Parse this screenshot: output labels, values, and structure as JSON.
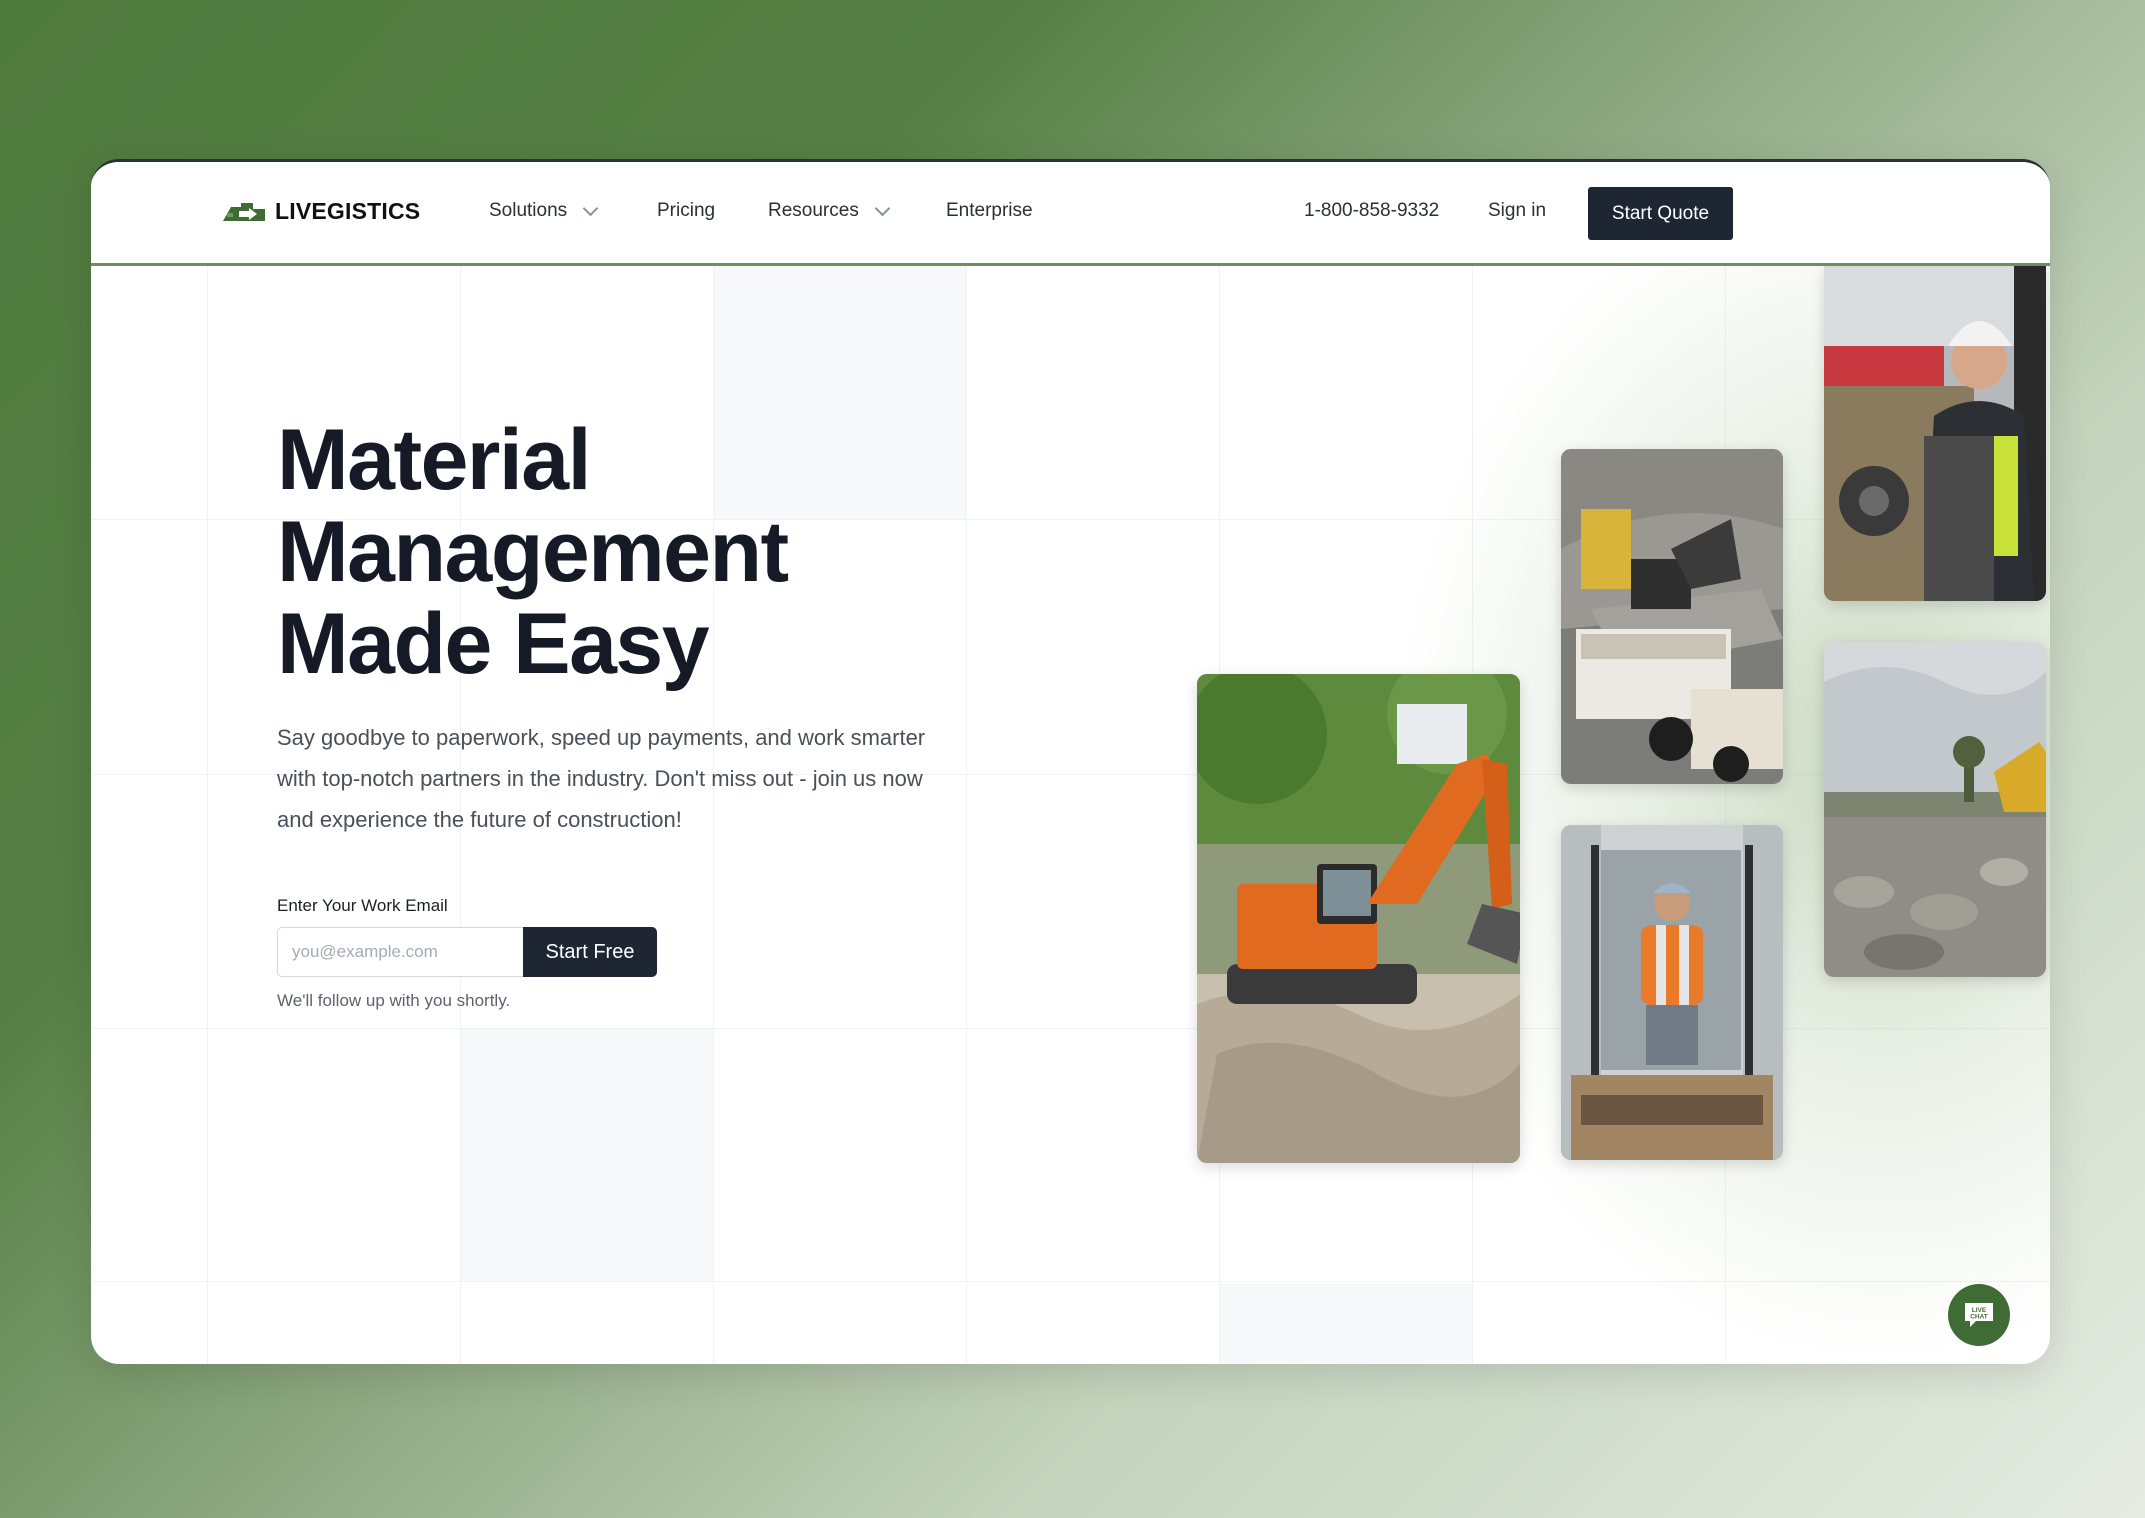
{
  "brand": {
    "name": "LIVEGISTICS",
    "accent": "#4f7a3e",
    "dark": "#1f2633"
  },
  "nav": {
    "items": [
      {
        "label": "Solutions",
        "dropdown": true
      },
      {
        "label": "Pricing",
        "dropdown": false
      },
      {
        "label": "Resources",
        "dropdown": true
      },
      {
        "label": "Enterprise",
        "dropdown": false
      }
    ],
    "phone": "1-800-858-9332",
    "signin": "Sign in",
    "cta": "Start Quote"
  },
  "hero": {
    "headline": [
      "Material",
      "Management",
      "Made Easy"
    ],
    "subtext": "Say goodbye to paperwork, speed up payments, and work smarter with top-notch partners in the industry. Don't miss out - join us now and experience the future of construction!",
    "email_label": "Enter Your Work Email",
    "email_placeholder": "you@example.com",
    "submit": "Start Free",
    "note": "We'll follow up with you shortly."
  },
  "photos": [
    {
      "name": "excavator-photo",
      "subject": "orange excavator on dirt site"
    },
    {
      "name": "dump-truck-photo",
      "subject": "loader filling dump trucks with gravel"
    },
    {
      "name": "loader-operator-photo",
      "subject": "worker operating skid steer"
    },
    {
      "name": "worker-portrait-photo",
      "subject": "construction worker in hard hat"
    },
    {
      "name": "rubble-site-photo",
      "subject": "rubble at demolition site"
    }
  ],
  "chat": {
    "label": "LIVE CHAT",
    "icon": "chat-bubble-icon"
  }
}
